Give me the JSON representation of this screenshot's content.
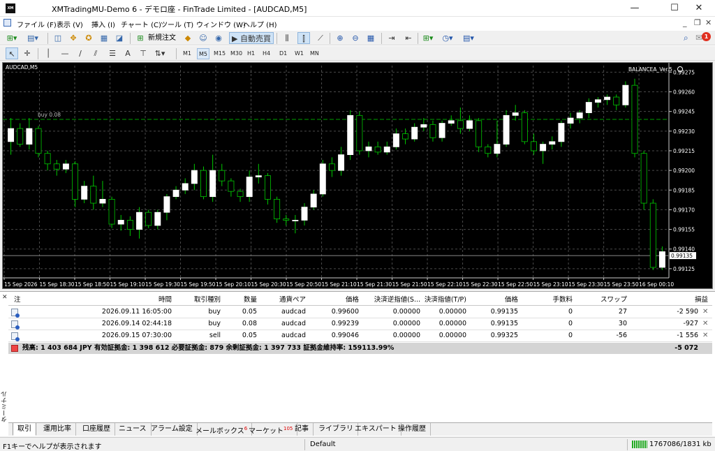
{
  "window": {
    "title": "XMTradingMU-Demo 6 - デモロ座 - FinTrade Limited - [AUDCAD,M5]",
    "logo": "XM"
  },
  "menu": [
    "ファイル (F)",
    "表示 (V)",
    "挿入 (I)",
    "チャート (C)",
    "ツール (T)",
    "ウィンドウ (W)",
    "ヘルプ (H)"
  ],
  "toolbar": {
    "new_order": "新規注文",
    "auto_trade": "自動売買",
    "timeframes": [
      "M1",
      "M5",
      "M15",
      "M30",
      "H1",
      "H4",
      "D1",
      "W1",
      "MN"
    ],
    "active_timeframe": "M5"
  },
  "notifications": {
    "count": "1"
  },
  "chart_data": {
    "type": "candlestick",
    "symbol_label": "AUDCAD,M5",
    "indicator_label": "BALANCEA_Ver.5",
    "line_label": "buy 0.08",
    "order_line_price": 0.99239,
    "current_price_label": "0.99135",
    "ylim": [
      0.99118,
      0.9928
    ],
    "y_ticks": [
      "0.99275",
      "0.99260",
      "0.99245",
      "0.99230",
      "0.99215",
      "0.99200",
      "0.99185",
      "0.99170",
      "0.99155",
      "0.99140",
      "0.99125"
    ],
    "x_ticks": [
      "15 Sep 2026",
      "15 Sep 18:30",
      "15 Sep 18:50",
      "15 Sep 19:10",
      "15 Sep 19:30",
      "15 Sep 19:50",
      "15 Sep 20:10",
      "15 Sep 20:30",
      "15 Sep 20:50",
      "15 Sep 21:10",
      "15 Sep 21:30",
      "15 Sep 21:50",
      "15 Sep 22:10",
      "15 Sep 22:30",
      "15 Sep 22:50",
      "15 Sep 23:10",
      "15 Sep 23:30",
      "15 Sep 23:50",
      "16 Sep 00:10"
    ],
    "candles": [
      [
        0.99222,
        0.99232,
        0.99212,
        0.9924
      ],
      [
        0.99232,
        0.9922,
        0.99218,
        0.99236
      ],
      [
        0.9922,
        0.99232,
        0.99216,
        0.9924
      ],
      [
        0.99232,
        0.99213,
        0.9921,
        0.99234
      ],
      [
        0.99213,
        0.99205,
        0.992,
        0.99215
      ],
      [
        0.99205,
        0.99201,
        0.99196,
        0.99208
      ],
      [
        0.99201,
        0.99205,
        0.99198,
        0.99208
      ],
      [
        0.99205,
        0.99178,
        0.99172,
        0.99207
      ],
      [
        0.99178,
        0.99188,
        0.99175,
        0.99192
      ],
      [
        0.99188,
        0.99175,
        0.9917,
        0.99196
      ],
      [
        0.99175,
        0.99178,
        0.99172,
        0.99192
      ],
      [
        0.99178,
        0.99159,
        0.99156,
        0.9918
      ],
      [
        0.99159,
        0.99162,
        0.99154,
        0.99166
      ],
      [
        0.99162,
        0.99155,
        0.9915,
        0.99165
      ],
      [
        0.99155,
        0.99168,
        0.99148,
        0.99172
      ],
      [
        0.99168,
        0.99158,
        0.99156,
        0.9917
      ],
      [
        0.99158,
        0.99168,
        0.99155,
        0.9917
      ],
      [
        0.99168,
        0.9918,
        0.99162,
        0.99182
      ],
      [
        0.9918,
        0.99185,
        0.99178,
        0.99188
      ],
      [
        0.99185,
        0.9919,
        0.99182,
        0.99194
      ],
      [
        0.9919,
        0.992,
        0.99185,
        0.99205
      ],
      [
        0.992,
        0.9918,
        0.99178,
        0.99203
      ],
      [
        0.9918,
        0.992,
        0.99176,
        0.99212
      ],
      [
        0.992,
        0.99192,
        0.99188,
        0.99205
      ],
      [
        0.99192,
        0.99184,
        0.9918,
        0.99194
      ],
      [
        0.99184,
        0.9918,
        0.99176,
        0.99186
      ],
      [
        0.9918,
        0.99195,
        0.99176,
        0.992
      ],
      [
        0.99195,
        0.99196,
        0.9919,
        0.99205
      ],
      [
        0.99196,
        0.99178,
        0.99174,
        0.99198
      ],
      [
        0.99178,
        0.99163,
        0.9916,
        0.9918
      ],
      [
        0.99163,
        0.99162,
        0.99158,
        0.99166
      ],
      [
        0.99162,
        0.99162,
        0.99152,
        0.99166
      ],
      [
        0.99162,
        0.99172,
        0.99158,
        0.99175
      ],
      [
        0.99172,
        0.99182,
        0.9917,
        0.99185
      ],
      [
        0.99182,
        0.99205,
        0.9918,
        0.99208
      ],
      [
        0.99205,
        0.992,
        0.99195,
        0.9921
      ],
      [
        0.992,
        0.99212,
        0.99196,
        0.99218
      ],
      [
        0.99212,
        0.99242,
        0.99208,
        0.99246
      ],
      [
        0.99242,
        0.99215,
        0.99212,
        0.99245
      ],
      [
        0.99215,
        0.99218,
        0.9921,
        0.99222
      ],
      [
        0.99218,
        0.99214,
        0.99212,
        0.99222
      ],
      [
        0.99214,
        0.99218,
        0.99212,
        0.99222
      ],
      [
        0.99218,
        0.99228,
        0.99216,
        0.99232
      ],
      [
        0.99228,
        0.99224,
        0.9922,
        0.99232
      ],
      [
        0.99224,
        0.99233,
        0.99222,
        0.99236
      ],
      [
        0.99233,
        0.99235,
        0.9923,
        0.9924
      ],
      [
        0.99235,
        0.99225,
        0.99222,
        0.99238
      ],
      [
        0.99225,
        0.99236,
        0.99222,
        0.99238
      ],
      [
        0.99236,
        0.99238,
        0.99234,
        0.99242
      ],
      [
        0.99238,
        0.99232,
        0.99228,
        0.99248
      ],
      [
        0.99232,
        0.99238,
        0.9923,
        0.99242
      ],
      [
        0.99238,
        0.99218,
        0.99214,
        0.9924
      ],
      [
        0.99218,
        0.99213,
        0.9921,
        0.9922
      ],
      [
        0.99213,
        0.9922,
        0.9921,
        0.99238
      ],
      [
        0.9922,
        0.99242,
        0.99218,
        0.99246
      ],
      [
        0.99242,
        0.99244,
        0.99238,
        0.9925
      ],
      [
        0.99244,
        0.99222,
        0.9922,
        0.99246
      ],
      [
        0.99222,
        0.99215,
        0.99212,
        0.99228
      ],
      [
        0.99215,
        0.9922,
        0.99205,
        0.99222
      ],
      [
        0.9922,
        0.99222,
        0.99216,
        0.99226
      ],
      [
        0.99222,
        0.99236,
        0.99218,
        0.99238
      ],
      [
        0.99236,
        0.9924,
        0.99232,
        0.99244
      ],
      [
        0.9924,
        0.99244,
        0.99236,
        0.99246
      ],
      [
        0.99244,
        0.99252,
        0.9924,
        0.99255
      ],
      [
        0.99252,
        0.99254,
        0.99248,
        0.99256
      ],
      [
        0.99254,
        0.99256,
        0.9925,
        0.99258
      ],
      [
        0.99256,
        0.9925,
        0.99246,
        0.99258
      ],
      [
        0.9925,
        0.99265,
        0.99248,
        0.99268
      ],
      [
        0.99265,
        0.99213,
        0.9921,
        0.9927
      ],
      [
        0.99213,
        0.99175,
        0.9917,
        0.99215
      ],
      [
        0.99175,
        0.99126,
        0.99124,
        0.99178
      ],
      [
        0.99126,
        0.99138,
        0.99124,
        0.99142
      ]
    ]
  },
  "terminal": {
    "side_label": "ターミナル",
    "columns": [
      "注",
      "時間",
      "取引種別",
      "数量",
      "通貨ペア",
      "価格",
      "決済逆指値(S...",
      "決済指値(T/P)",
      "価格",
      "手数料",
      "スワップ",
      "損益"
    ],
    "rows": [
      {
        "time": "2026.09.11 16:05:00",
        "type": "buy",
        "volume": "0.05",
        "symbol": "audcad",
        "price": "0.99600",
        "sl": "0.00000",
        "tp": "0.00000",
        "cur_price": "0.99135",
        "commission": "0",
        "swap": "27",
        "profit": "-2 590"
      },
      {
        "time": "2026.09.14 02:44:18",
        "type": "buy",
        "volume": "0.08",
        "symbol": "audcad",
        "price": "0.99239",
        "sl": "0.00000",
        "tp": "0.00000",
        "cur_price": "0.99135",
        "commission": "0",
        "swap": "30",
        "profit": "-927"
      },
      {
        "time": "2026.09.15 07:30:00",
        "type": "sell",
        "volume": "0.05",
        "symbol": "audcad",
        "price": "0.99046",
        "sl": "0.00000",
        "tp": "0.00000",
        "cur_price": "0.99325",
        "commission": "0",
        "swap": "-56",
        "profit": "-1 556"
      }
    ],
    "summary": {
      "text": "残高: 1 403 684 JPY  有効証拠金: 1 398 612  必要証拠金: 879  余剰証拠金: 1 397 733  証拠金維持率: 159113.99%",
      "total": "-5 072"
    },
    "tabs": [
      {
        "label": "取引",
        "badge": ""
      },
      {
        "label": "運用比率",
        "badge": ""
      },
      {
        "label": "口座履歴",
        "badge": ""
      },
      {
        "label": "ニュース",
        "badge": ""
      },
      {
        "label": "アラーム設定",
        "badge": ""
      },
      {
        "label": "メールボックス",
        "badge": "6"
      },
      {
        "label": "マーケット",
        "badge": "105"
      },
      {
        "label": "記事",
        "badge": ""
      },
      {
        "label": "ライブラリ",
        "badge": ""
      },
      {
        "label": "エキスパート",
        "badge": ""
      },
      {
        "label": "操作履歴",
        "badge": ""
      }
    ]
  },
  "status": {
    "help": "F1キーでヘルプが表示されます",
    "profile": "Default",
    "traffic": "1767086/1831 kb"
  },
  "colors": {
    "bull": "#ffffff",
    "bear": "#000000",
    "wick": "#00c800",
    "grid": "#4a4a4a",
    "order_line": "#00a000",
    "text": "#ffffff"
  }
}
